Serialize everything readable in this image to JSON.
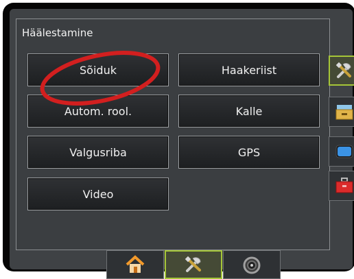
{
  "panel": {
    "title": "Häälestamine"
  },
  "menu": {
    "buttons": [
      {
        "label": "Sõiduk"
      },
      {
        "label": "Haakeriist"
      },
      {
        "label": "Autom. rool."
      },
      {
        "label": "Kalle"
      },
      {
        "label": "Valgusriba"
      },
      {
        "label": "GPS"
      },
      {
        "label": "Video"
      }
    ]
  },
  "side_tabs": [
    {
      "icon": "tools-icon",
      "active": true
    },
    {
      "icon": "storage-drawer-icon",
      "active": false
    },
    {
      "icon": "display-icon",
      "active": false
    },
    {
      "icon": "toolbox-icon",
      "active": false
    }
  ],
  "bottom_tabs": [
    {
      "icon": "home-icon"
    },
    {
      "icon": "tools-icon",
      "active": true
    },
    {
      "icon": "speedometer-icon"
    }
  ],
  "colors": {
    "accent": "#a6c638",
    "annotation": "#d21f1f"
  }
}
